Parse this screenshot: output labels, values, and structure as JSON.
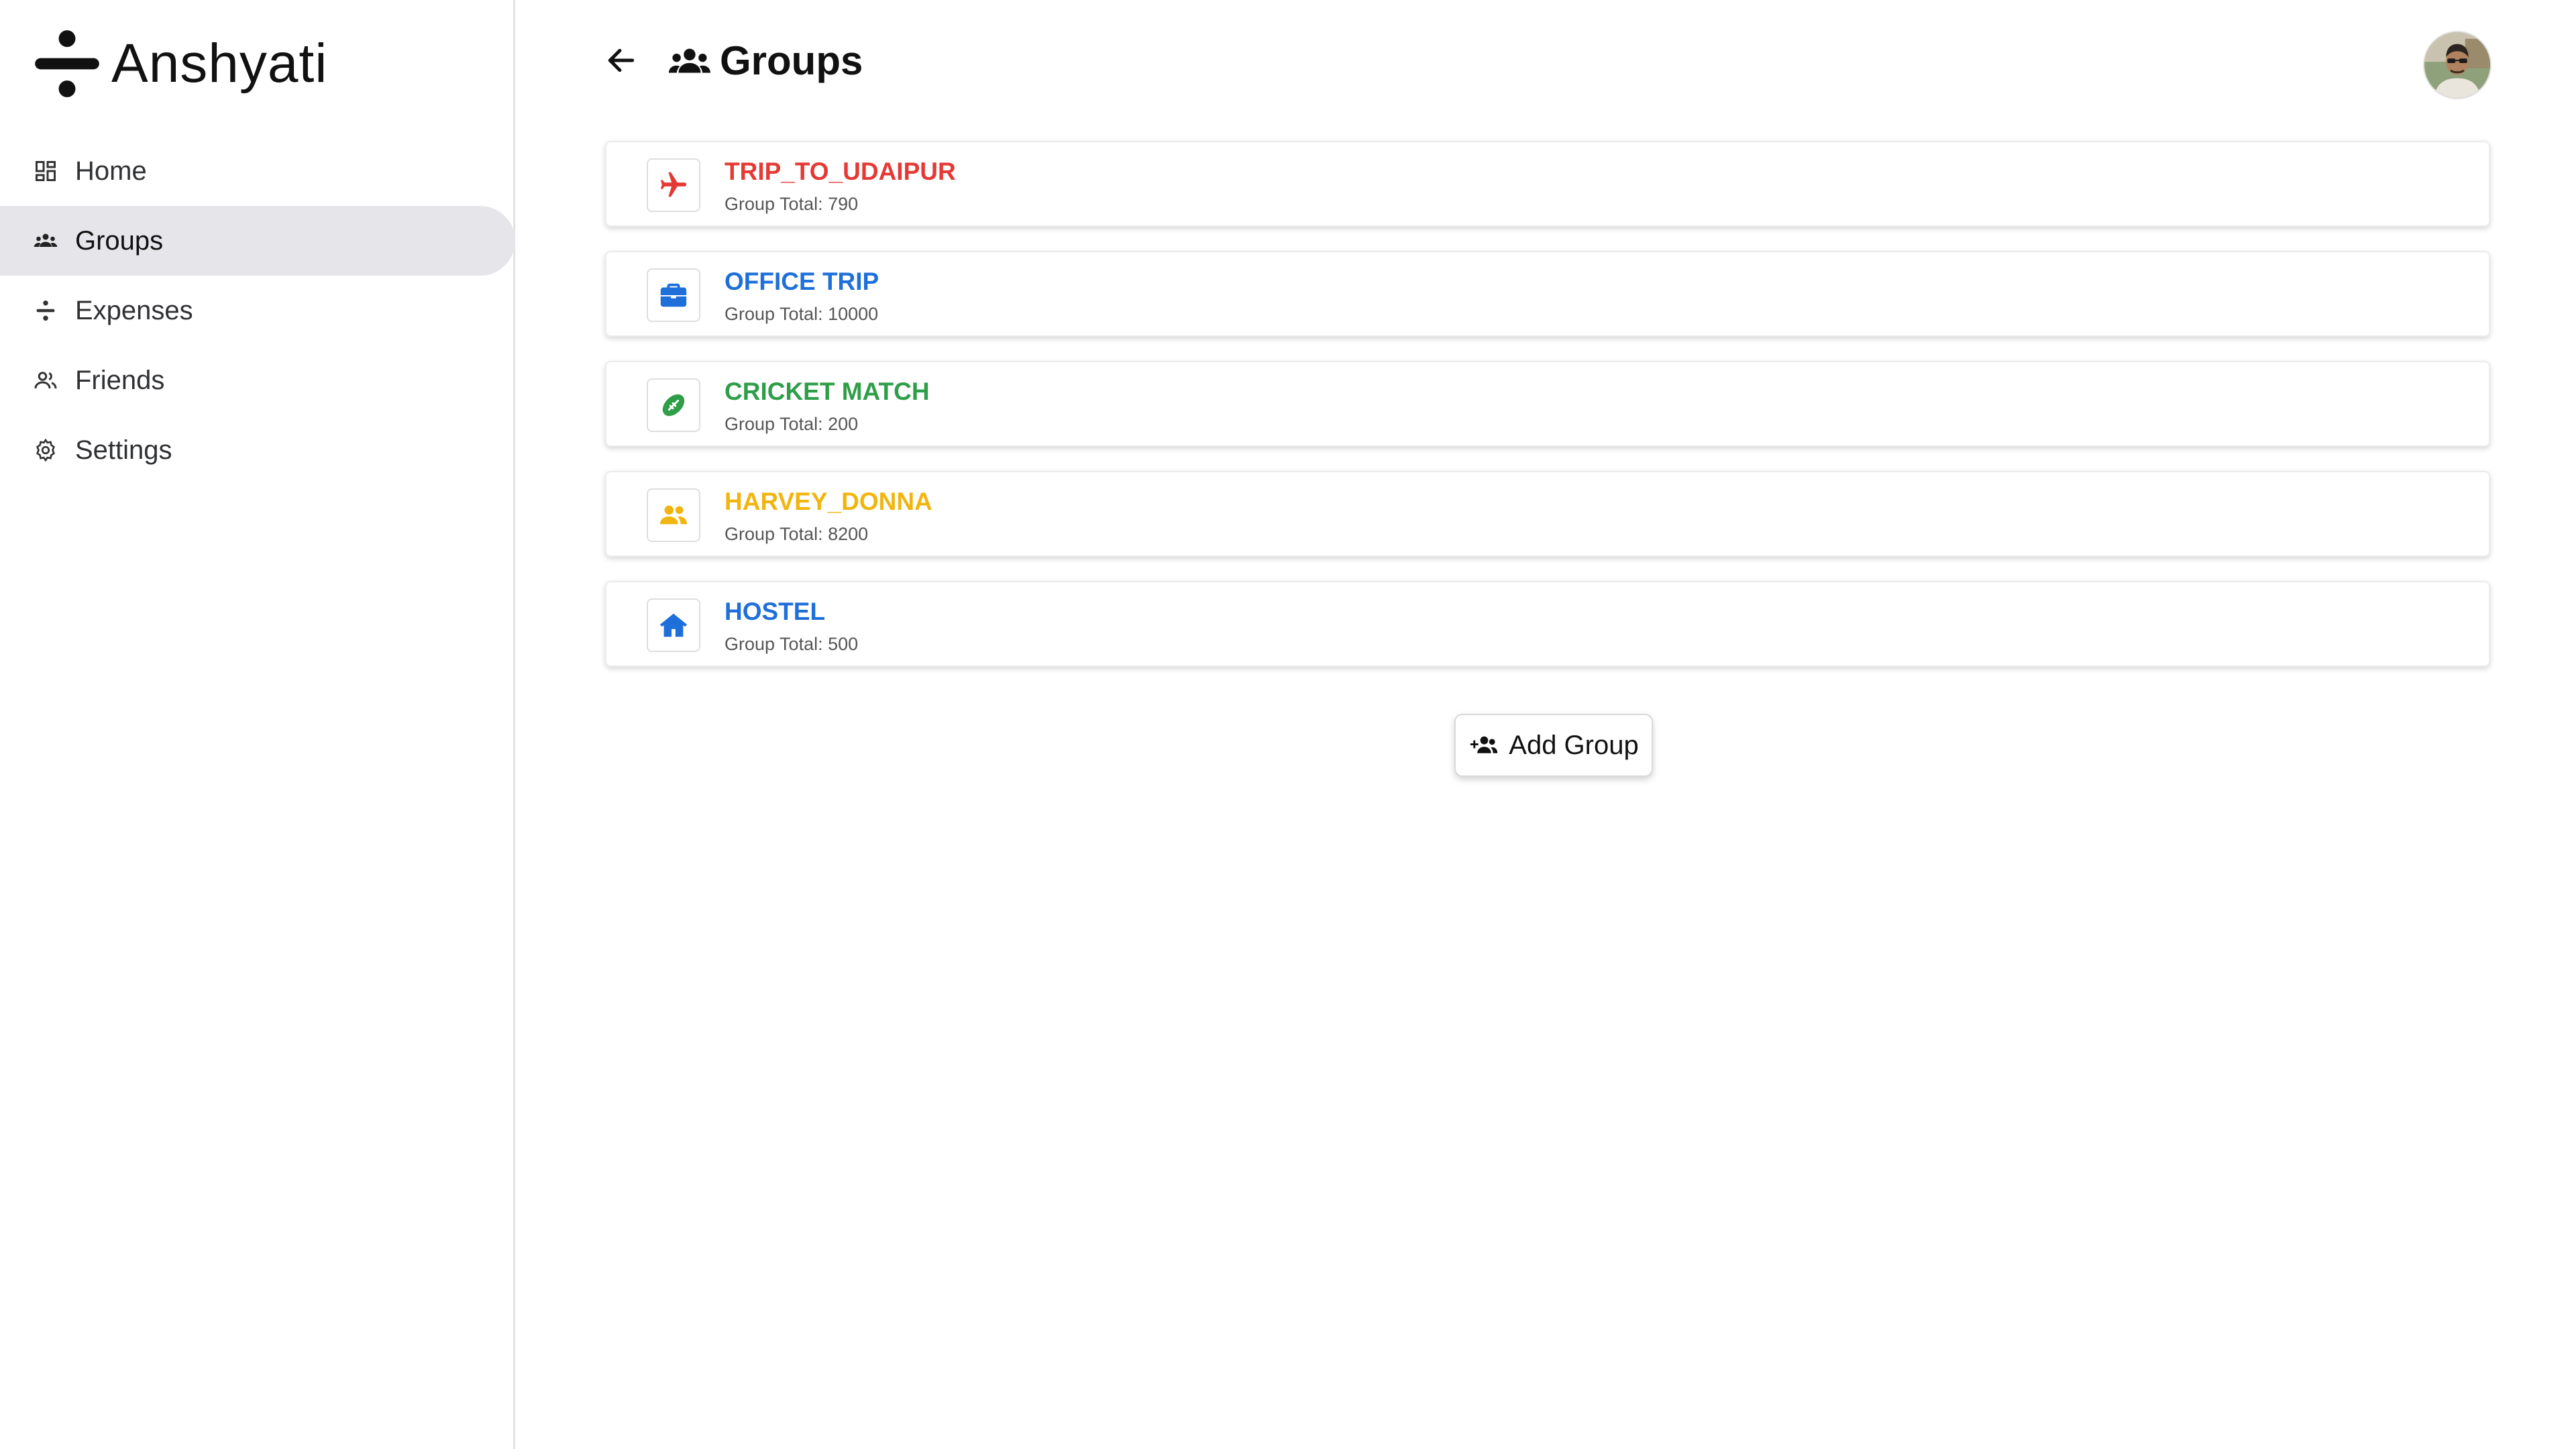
{
  "app": {
    "name": "Anshyati"
  },
  "sidebar": {
    "items": [
      {
        "label": "Home",
        "icon": "dashboard-icon",
        "active": false
      },
      {
        "label": "Groups",
        "icon": "groups-icon",
        "active": true
      },
      {
        "label": "Expenses",
        "icon": "expenses-icon",
        "active": false
      },
      {
        "label": "Friends",
        "icon": "friends-icon",
        "active": false
      },
      {
        "label": "Settings",
        "icon": "gear-icon",
        "active": false
      }
    ]
  },
  "header": {
    "title": "Groups"
  },
  "groups": [
    {
      "name": "TRIP_TO_UDAIPUR",
      "total": "Group Total: 790",
      "icon": "airplane-icon",
      "color": "#e53935"
    },
    {
      "name": "OFFICE TRIP",
      "total": "Group Total: 10000",
      "icon": "briefcase-icon",
      "color": "#1e6fd9"
    },
    {
      "name": "CRICKET MATCH",
      "total": "Group Total: 200",
      "icon": "ball-icon",
      "color": "#2e9e48"
    },
    {
      "name": "HARVEY_DONNA",
      "total": "Group Total: 8200",
      "icon": "people-icon",
      "color": "#f2b50f"
    },
    {
      "name": "HOSTEL",
      "total": "Group Total: 500",
      "icon": "home-icon",
      "color": "#1e6fd9"
    }
  ],
  "actions": {
    "add_group_label": "Add Group"
  }
}
